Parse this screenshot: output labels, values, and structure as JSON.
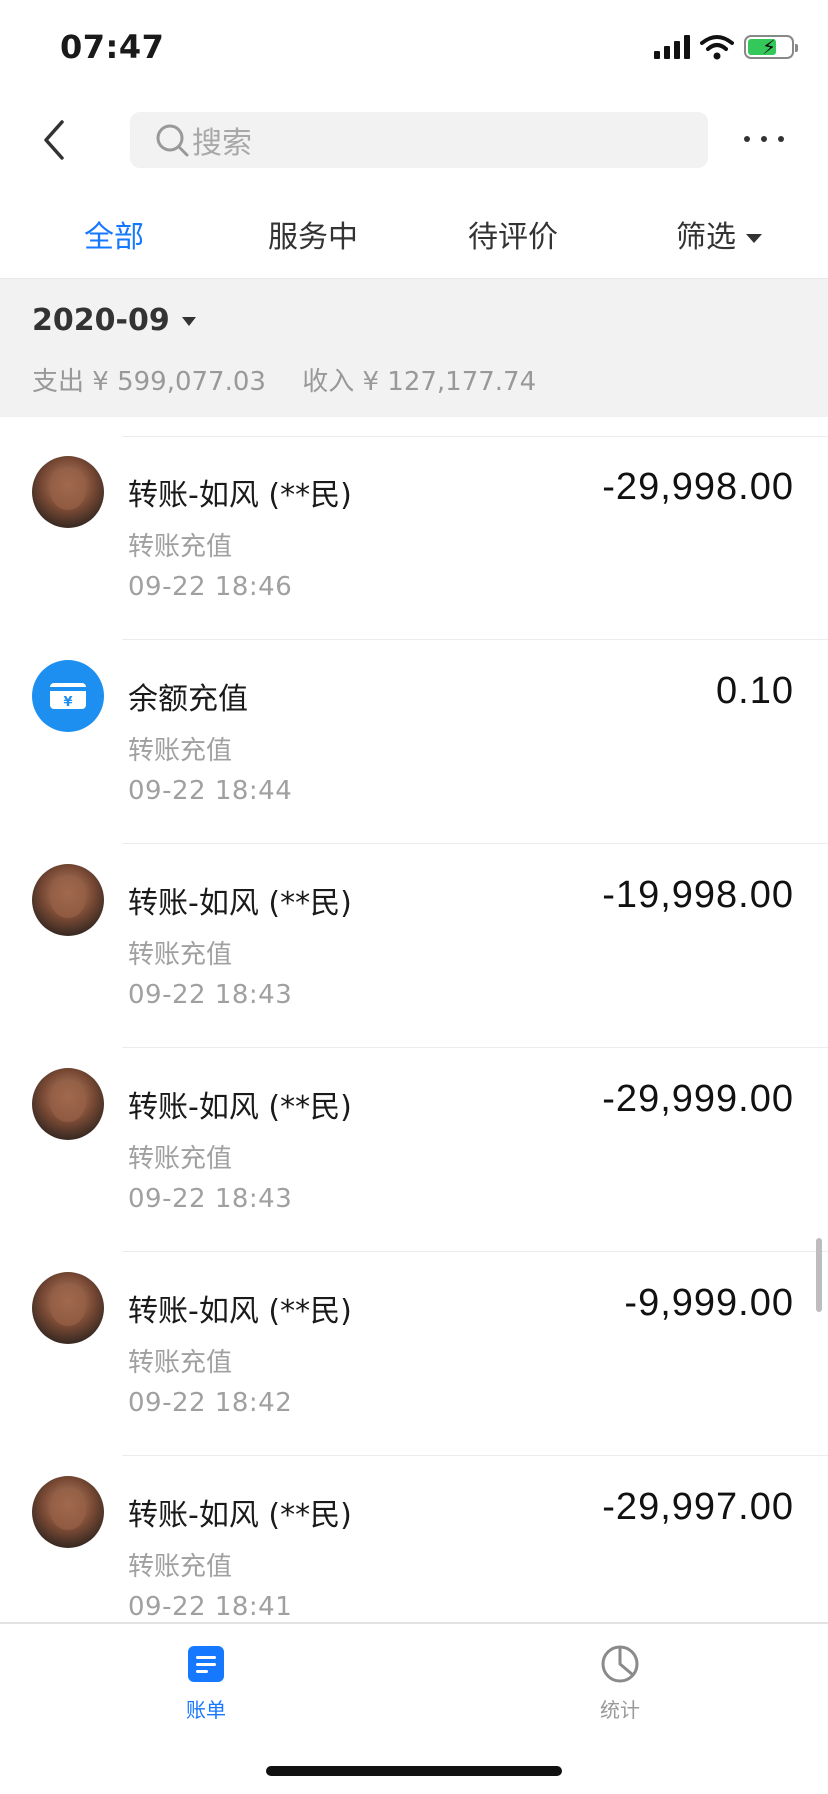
{
  "status_bar": {
    "time": "07:47"
  },
  "nav": {
    "search_placeholder": "搜索"
  },
  "tabs": [
    {
      "label": "全部",
      "active": true
    },
    {
      "label": "服务中",
      "active": false
    },
    {
      "label": "待评价",
      "active": false
    },
    {
      "label": "筛选",
      "active": false
    }
  ],
  "month": {
    "label": "2020-09",
    "expense": "支出 ¥ 599,077.03",
    "income": "收入 ¥ 127,177.74"
  },
  "transactions": [
    {
      "title": "转账-如风 (**民)",
      "subtitle": "转账充值",
      "time": "09-22  18:46",
      "amount": "-29,998.00",
      "icon": "avatar"
    },
    {
      "title": "余额充值",
      "subtitle": "转账充值",
      "time": "09-22  18:44",
      "amount": "0.10",
      "icon": "card-yen-icon"
    },
    {
      "title": "转账-如风 (**民)",
      "subtitle": "转账充值",
      "time": "09-22  18:43",
      "amount": "-19,998.00",
      "icon": "avatar"
    },
    {
      "title": "转账-如风 (**民)",
      "subtitle": "转账充值",
      "time": "09-22  18:43",
      "amount": "-29,999.00",
      "icon": "avatar"
    },
    {
      "title": "转账-如风 (**民)",
      "subtitle": "转账充值",
      "time": "09-22  18:42",
      "amount": "-9,999.00",
      "icon": "avatar"
    },
    {
      "title": "转账-如风 (**民)",
      "subtitle": "转账充值",
      "time": "09-22  18:41",
      "amount": "-29,997.00",
      "icon": "avatar"
    }
  ],
  "tab_bar": [
    {
      "label": "账单",
      "active": true,
      "icon": "bill-icon"
    },
    {
      "label": "统计",
      "active": false,
      "icon": "pie-chart-icon"
    }
  ],
  "colors": {
    "accent": "#1677ff",
    "card_icon": "#1d8ff0",
    "muted": "#a0a0a0"
  }
}
